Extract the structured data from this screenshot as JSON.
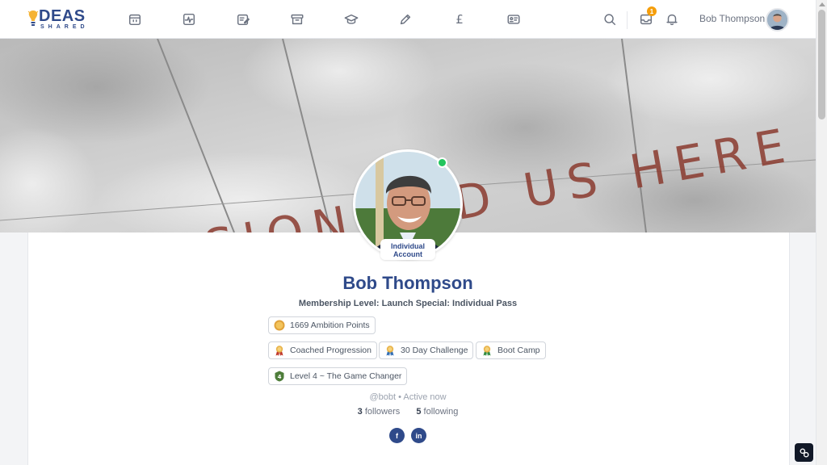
{
  "header": {
    "logo_text": "DEAS",
    "logo_sub": "SHARED",
    "nav_icons": [
      "store-icon",
      "activity-icon",
      "edit-note-icon",
      "archive-icon",
      "graduation-cap-icon",
      "pencil-icon",
      "pound-icon",
      "id-card-icon"
    ],
    "pound_symbol": "£",
    "search_icon": "search-icon",
    "inbox_icon": "inbox-icon",
    "inbox_badge": "1",
    "bell_icon": "bell-icon",
    "user_name": "Bob Thompson"
  },
  "cover": {
    "text_line": "PASSION LED US HERE"
  },
  "profile": {
    "account_type": "Individual Account",
    "name": "Bob Thompson",
    "membership": "Membership Level: Launch Special: Individual Pass",
    "points_chip": "1669 Ambition Points",
    "badges": [
      "Coached Progression",
      "30 Day Challenge",
      "Boot Camp"
    ],
    "level_chip": "Level 4 ~ The Game Changer",
    "handle_line": "@bobt • Active now",
    "followers_count": "3",
    "followers_label": "followers",
    "following_count": "5",
    "following_label": "following",
    "social": [
      "f",
      "in"
    ]
  },
  "colors": {
    "brand": "#2f4a8a",
    "online": "#22c55e",
    "badge": "#f59e0b"
  }
}
